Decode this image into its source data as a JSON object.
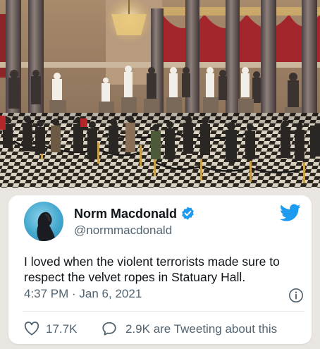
{
  "tweet": {
    "display_name": "Norm Macdonald",
    "handle": "@normmacdonald",
    "verified": true,
    "text": "I loved when the violent terrorists made sure to respect the velvet ropes in Statuary Hall.",
    "timestamp": "4:37 PM · Jan 6, 2021",
    "likes": "17.7K",
    "replies_text": "2.9K are Tweeting about this"
  },
  "icons": {
    "verified": "verified-badge-icon",
    "logo": "twitter-bird-icon",
    "info": "info-icon",
    "like": "heart-icon",
    "reply": "speech-bubble-icon"
  },
  "colors": {
    "twitter_blue": "#1d9bf0",
    "text_primary": "#0f1419",
    "text_secondary": "#536471",
    "card_background": "#ffffff"
  }
}
